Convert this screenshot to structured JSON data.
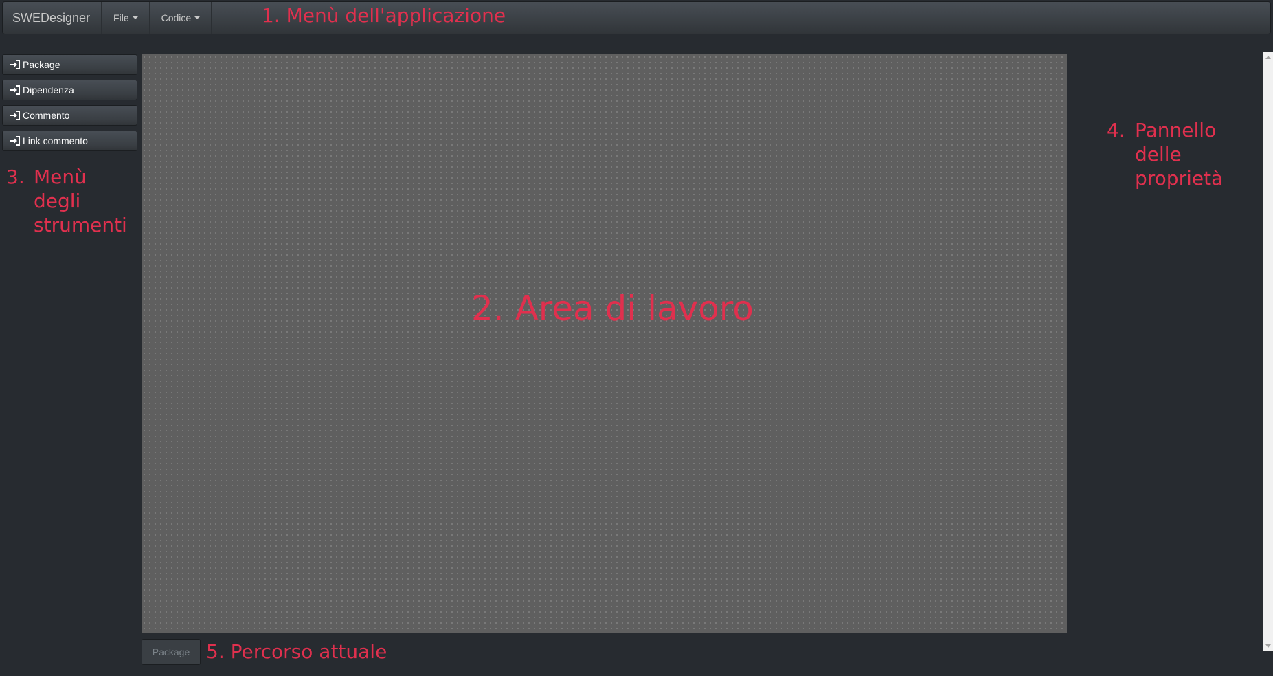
{
  "navbar": {
    "brand": "SWEDesigner",
    "menus": [
      {
        "label": "File"
      },
      {
        "label": "Codice"
      }
    ]
  },
  "tools": [
    {
      "label": "Package",
      "icon": "sign-in-icon"
    },
    {
      "label": "Dipendenza",
      "icon": "sign-in-icon"
    },
    {
      "label": "Commento",
      "icon": "sign-in-icon"
    },
    {
      "label": "Link commento",
      "icon": "sign-in-icon"
    }
  ],
  "breadcrumb": {
    "current": "Package"
  },
  "annotations": {
    "app_menu": "1. Menù dell'applicazione",
    "workspace": "2. Area di lavoro",
    "tools_number": "3.",
    "tools_lines": [
      "Menù",
      "degli",
      "strumenti"
    ],
    "properties_number": "4.",
    "properties_lines": [
      "Pannello",
      "delle",
      "proprietà"
    ],
    "path": "5. Percorso attuale"
  },
  "colors": {
    "background": "#272b30",
    "navbar": "#3a3f44",
    "canvas": "#5f5f5f",
    "annotation": "#e0304e"
  }
}
